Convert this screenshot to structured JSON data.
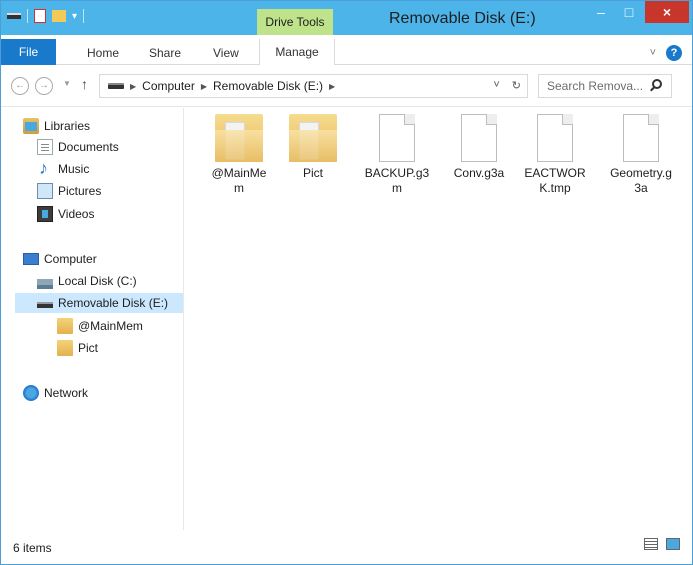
{
  "window": {
    "title": "Removable Disk (E:)",
    "context_tab": "Drive Tools",
    "controls": {
      "minimize": "–",
      "maximize": "□",
      "close": "×"
    }
  },
  "ribbon": {
    "tabs": [
      "File",
      "Home",
      "Share",
      "View",
      "Manage"
    ],
    "expand_icon": "chevron-down-icon",
    "help": "?"
  },
  "address": {
    "back": "←",
    "forward": "→",
    "up": "↑",
    "breadcrumb": [
      "Computer",
      "Removable Disk (E:)"
    ],
    "search_placeholder": "Search Remova..."
  },
  "nav_pane": {
    "groups": [
      {
        "label": "Libraries",
        "icon": "libraries-icon",
        "children": [
          {
            "label": "Documents",
            "icon": "document-icon"
          },
          {
            "label": "Music",
            "icon": "music-icon"
          },
          {
            "label": "Pictures",
            "icon": "pictures-icon"
          },
          {
            "label": "Videos",
            "icon": "videos-icon"
          }
        ]
      },
      {
        "label": "Computer",
        "icon": "computer-icon",
        "children": [
          {
            "label": "Local Disk (C:)",
            "icon": "local-disk-icon"
          },
          {
            "label": "Removable Disk (E:)",
            "icon": "removable-drive-icon",
            "selected": true
          },
          {
            "label": "@MainMem",
            "icon": "folder-icon"
          },
          {
            "label": "Pict",
            "icon": "folder-icon"
          }
        ]
      },
      {
        "label": "Network",
        "icon": "network-icon",
        "children": []
      }
    ]
  },
  "files": [
    {
      "name_line1": "@MainMe",
      "name_line2": "m",
      "type": "folder"
    },
    {
      "name_line1": "Pict",
      "name_line2": "",
      "type": "folder"
    },
    {
      "name_line1": "BACKUP.g3",
      "name_line2": "m",
      "type": "file"
    },
    {
      "name_line1": "Conv.g3a",
      "name_line2": "",
      "type": "file"
    },
    {
      "name_line1": "EACTWOR",
      "name_line2": "K.tmp",
      "type": "file"
    },
    {
      "name_line1": "Geometry.g",
      "name_line2": "3a",
      "type": "file"
    }
  ],
  "status": {
    "item_count": "6 items"
  },
  "colors": {
    "titlebar": "#4cb4e8",
    "file_tab": "#1979ca",
    "close": "#c7352b",
    "selected": "#cce8ff",
    "drive_tools": "#bfe38b"
  }
}
